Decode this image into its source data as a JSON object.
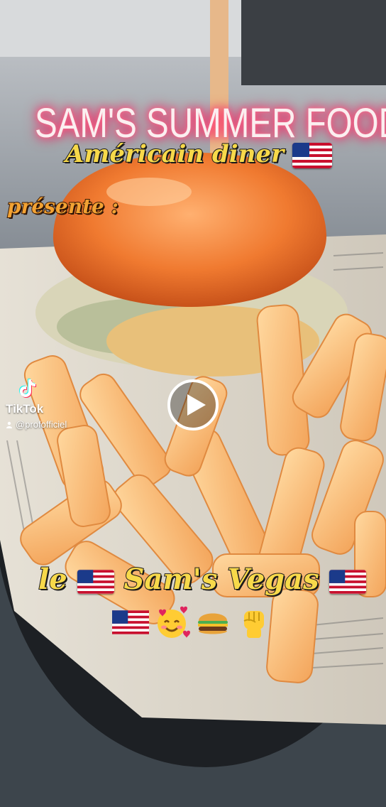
{
  "overlay": {
    "title": "SAM'S SUMMER FOOD",
    "subtitle": "Américain diner",
    "presente": "présente :",
    "name_text": "Sam's Vegas",
    "name_prefix": "le"
  },
  "emojis": [
    "flag-us-icon",
    "smiling-face-with-hearts-icon",
    "burger-icon",
    "raised-fist-icon"
  ],
  "watermark": {
    "brand": "TikTok",
    "username": "@profofficiel"
  },
  "controls": {
    "play": "play-icon"
  },
  "colors": {
    "title_glow": "#ff2d6a",
    "caption_yellow": "#f7d94a",
    "caption_orange": "#f2a233"
  }
}
